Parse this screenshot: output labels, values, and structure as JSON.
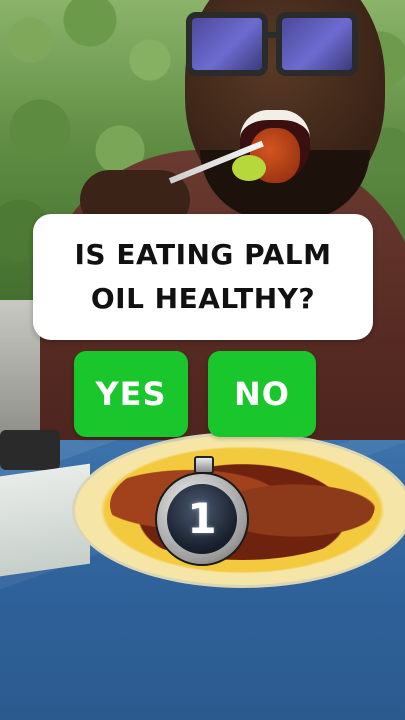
{
  "question": {
    "text": "IS EATING PALM OIL HEALTHY?"
  },
  "answers": {
    "yes_label": "YES",
    "no_label": "NO"
  },
  "timer": {
    "value": "1",
    "icon": "stopwatch-icon"
  },
  "colors": {
    "answer_green": "#19c62b",
    "card_white": "#ffffff",
    "question_text": "#111111"
  }
}
